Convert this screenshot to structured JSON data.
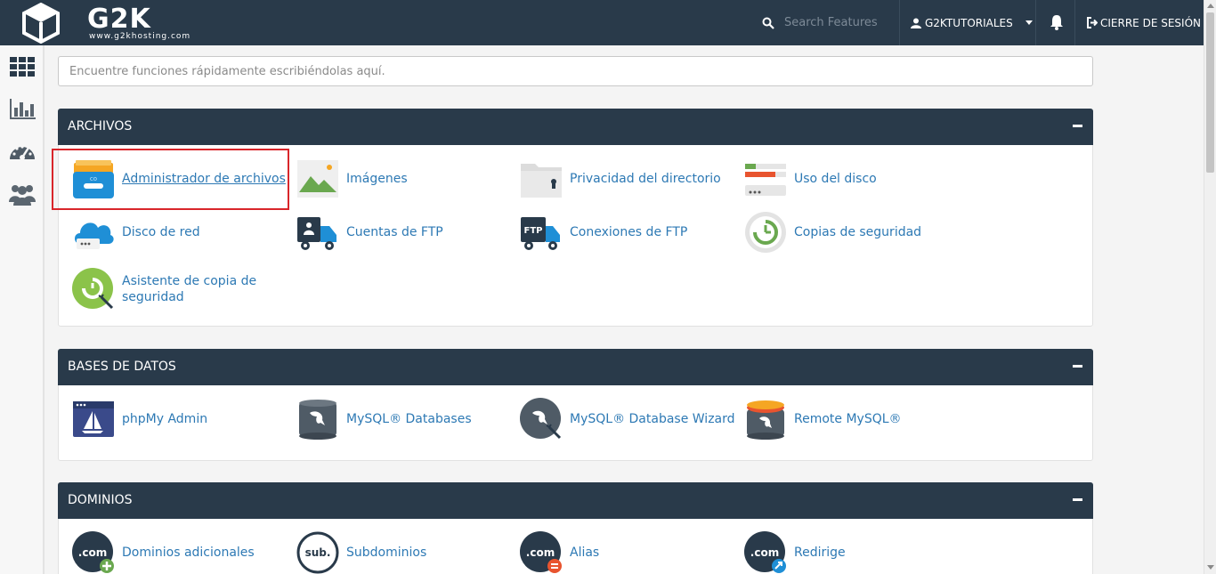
{
  "header": {
    "logo_word": "G2K",
    "logo_url": "www.g2khosting.com",
    "search_placeholder": "Search Features",
    "username": "G2KTUTORIALES",
    "logout_label": "CIERRE DE SESIÓN"
  },
  "quick_search": {
    "placeholder": "Encuentre funciones rápidamente escribiéndolas aquí."
  },
  "colors": {
    "header_bg": "#293a4a",
    "link": "#2d79b4",
    "highlight": "#d9262b"
  },
  "sidebar": {
    "icons": [
      "grid-icon",
      "bar-chart-icon",
      "dashboard-gauge-icon",
      "users-icon"
    ]
  },
  "sections": {
    "archivos": {
      "title": "ARCHIVOS",
      "items": [
        {
          "label": "Administrador de archivos",
          "icon": "file-manager-icon"
        },
        {
          "label": "Imágenes",
          "icon": "images-icon"
        },
        {
          "label": "Privacidad del directorio",
          "icon": "directory-privacy-icon"
        },
        {
          "label": "Uso del disco",
          "icon": "disk-usage-icon"
        },
        {
          "label": "Disco de red",
          "icon": "web-disk-icon"
        },
        {
          "label": "Cuentas de FTP",
          "icon": "ftp-accounts-icon"
        },
        {
          "label": "Conexiones de FTP",
          "icon": "ftp-connections-icon"
        },
        {
          "label": "Copias de seguridad",
          "icon": "backup-icon"
        },
        {
          "label": "Asistente de copia de seguridad",
          "icon": "backup-wizard-icon"
        }
      ]
    },
    "bases_de_datos": {
      "title": "BASES DE DATOS",
      "items": [
        {
          "label": "phpMy Admin",
          "icon": "phpmyadmin-icon"
        },
        {
          "label": "MySQL® Databases",
          "icon": "mysql-databases-icon"
        },
        {
          "label": "MySQL® Database Wizard",
          "icon": "mysql-wizard-icon"
        },
        {
          "label": "Remote MySQL®",
          "icon": "remote-mysql-icon"
        }
      ]
    },
    "dominios": {
      "title": "DOMINIOS",
      "items": [
        {
          "label": "Dominios adicionales",
          "icon": "addon-domains-icon",
          "glyph": ".com"
        },
        {
          "label": "Subdominios",
          "icon": "subdomains-icon",
          "glyph": "sub."
        },
        {
          "label": "Alias",
          "icon": "aliases-icon",
          "glyph": ".com"
        },
        {
          "label": "Redirige",
          "icon": "redirects-icon",
          "glyph": ".com"
        }
      ]
    }
  }
}
